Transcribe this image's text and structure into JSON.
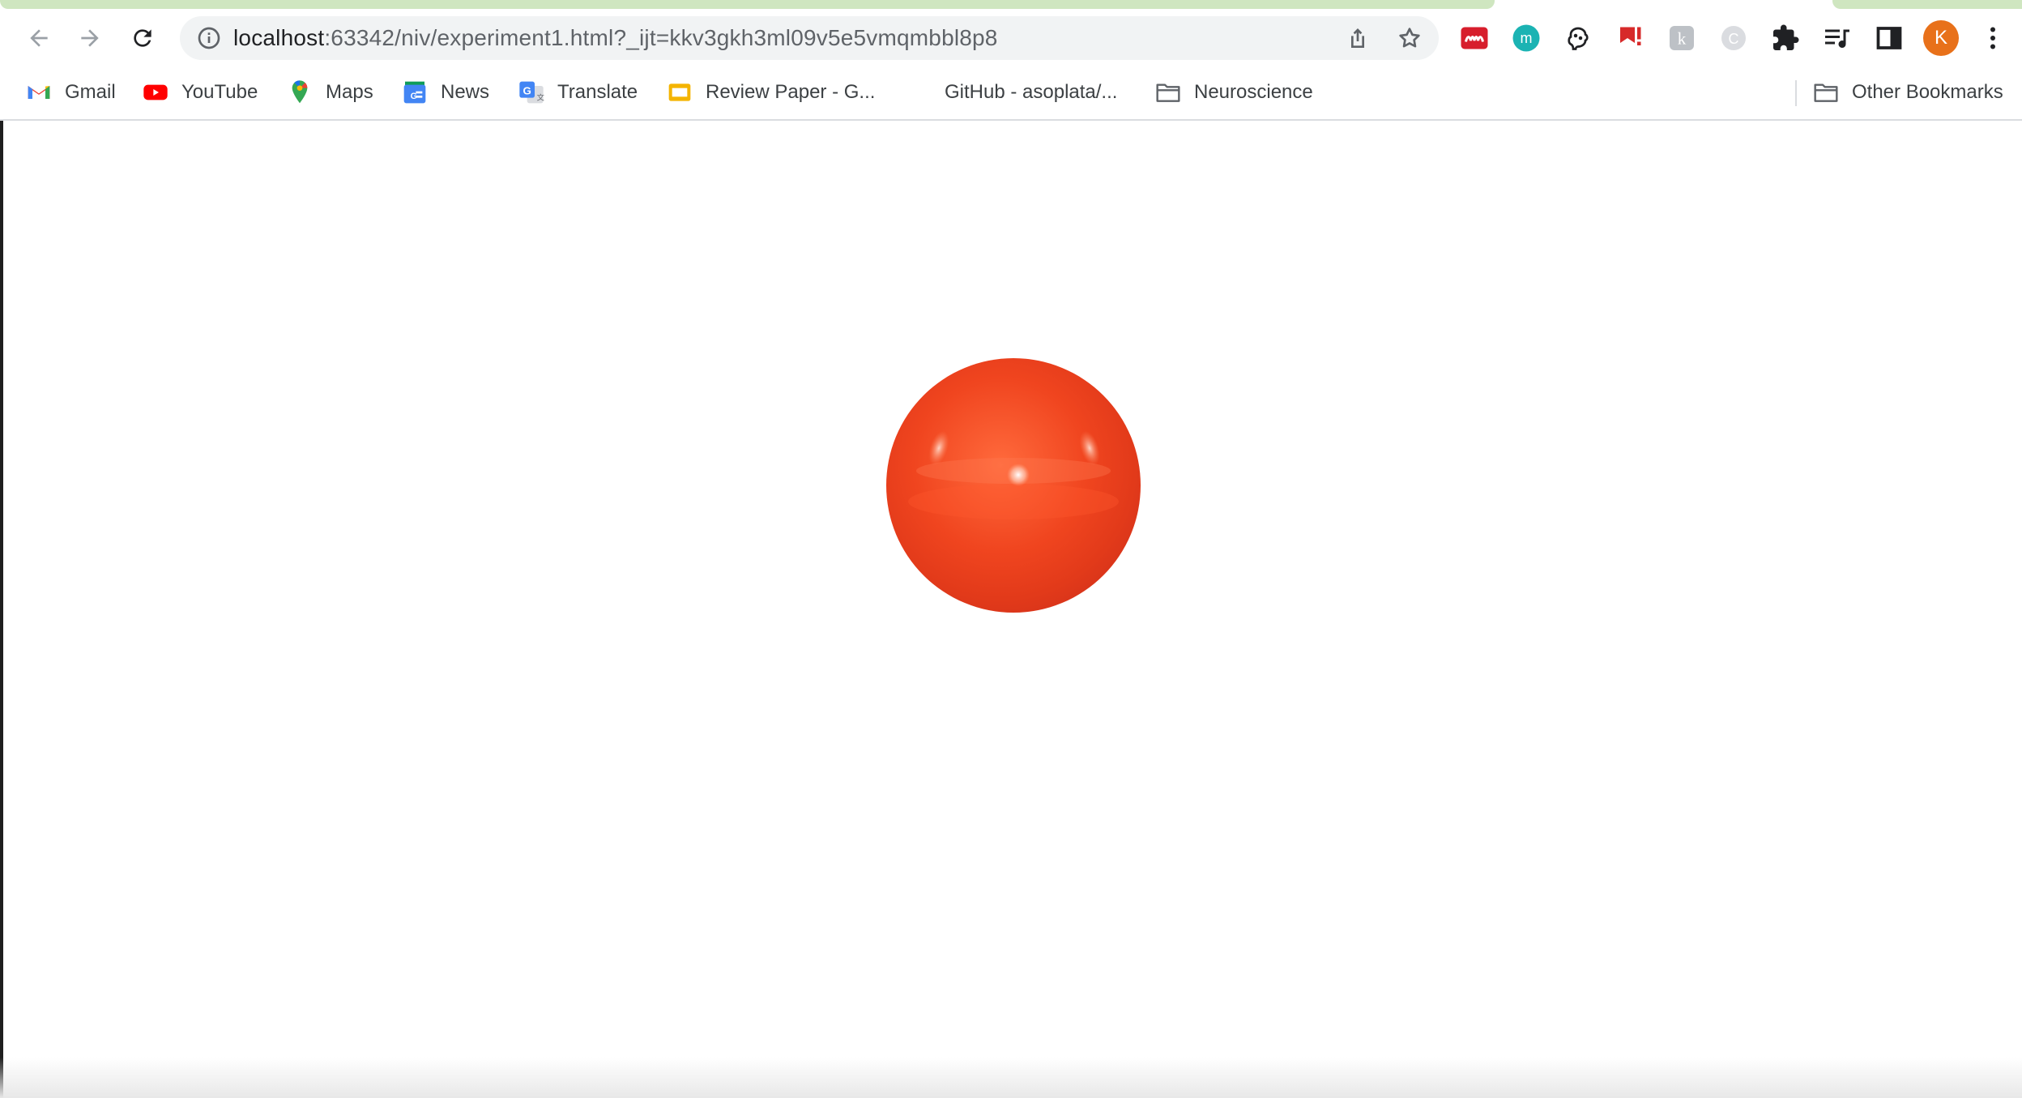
{
  "browser": {
    "nav": {
      "back_icon": "arrow-left-icon",
      "forward_icon": "arrow-right-icon",
      "reload_icon": "reload-icon"
    },
    "omnibox": {
      "host": "localhost",
      "path": ":63342/niv/experiment1.html?_ijt=kkv3gkh3ml09v5e5vmqmbbl8p8",
      "info_icon": "info-icon",
      "share_icon": "share-icon",
      "bookmark_icon": "star-icon"
    },
    "extensions": [
      {
        "name": "mendeley-extension",
        "color": "#d71e2c"
      },
      {
        "name": "m-extension",
        "color": "#1bb3b3"
      },
      {
        "name": "brain-extension",
        "color": "#202124"
      },
      {
        "name": "red-bookmark-extension",
        "color": "#d72a2a"
      },
      {
        "name": "gray-k-extension",
        "color": "#9aa0a6"
      },
      {
        "name": "gray-c-extension",
        "color": "#bdc1c6"
      },
      {
        "name": "puzzle-extension",
        "color": "#202124"
      }
    ],
    "reading_list_icon": "reading-list-icon",
    "side_panel_icon": "side-panel-icon",
    "profile_initial": "K",
    "menu_icon": "more-vert-icon"
  },
  "bookmarks": [
    {
      "label": "Gmail",
      "icon": "gmail-icon"
    },
    {
      "label": "YouTube",
      "icon": "youtube-icon"
    },
    {
      "label": "Maps",
      "icon": "maps-icon"
    },
    {
      "label": "News",
      "icon": "news-icon"
    },
    {
      "label": "Translate",
      "icon": "translate-icon"
    },
    {
      "label": "Review Paper - G...",
      "icon": "slides-icon"
    },
    {
      "label": "GitHub - asoplata/...",
      "icon": "github-icon"
    },
    {
      "label": "Neuroscience",
      "icon": "folder-icon"
    }
  ],
  "other_bookmarks": {
    "label": "Other Bookmarks",
    "icon": "folder-icon"
  },
  "page": {
    "stimulus": "red-ball",
    "ball_color": "#f0451f"
  }
}
